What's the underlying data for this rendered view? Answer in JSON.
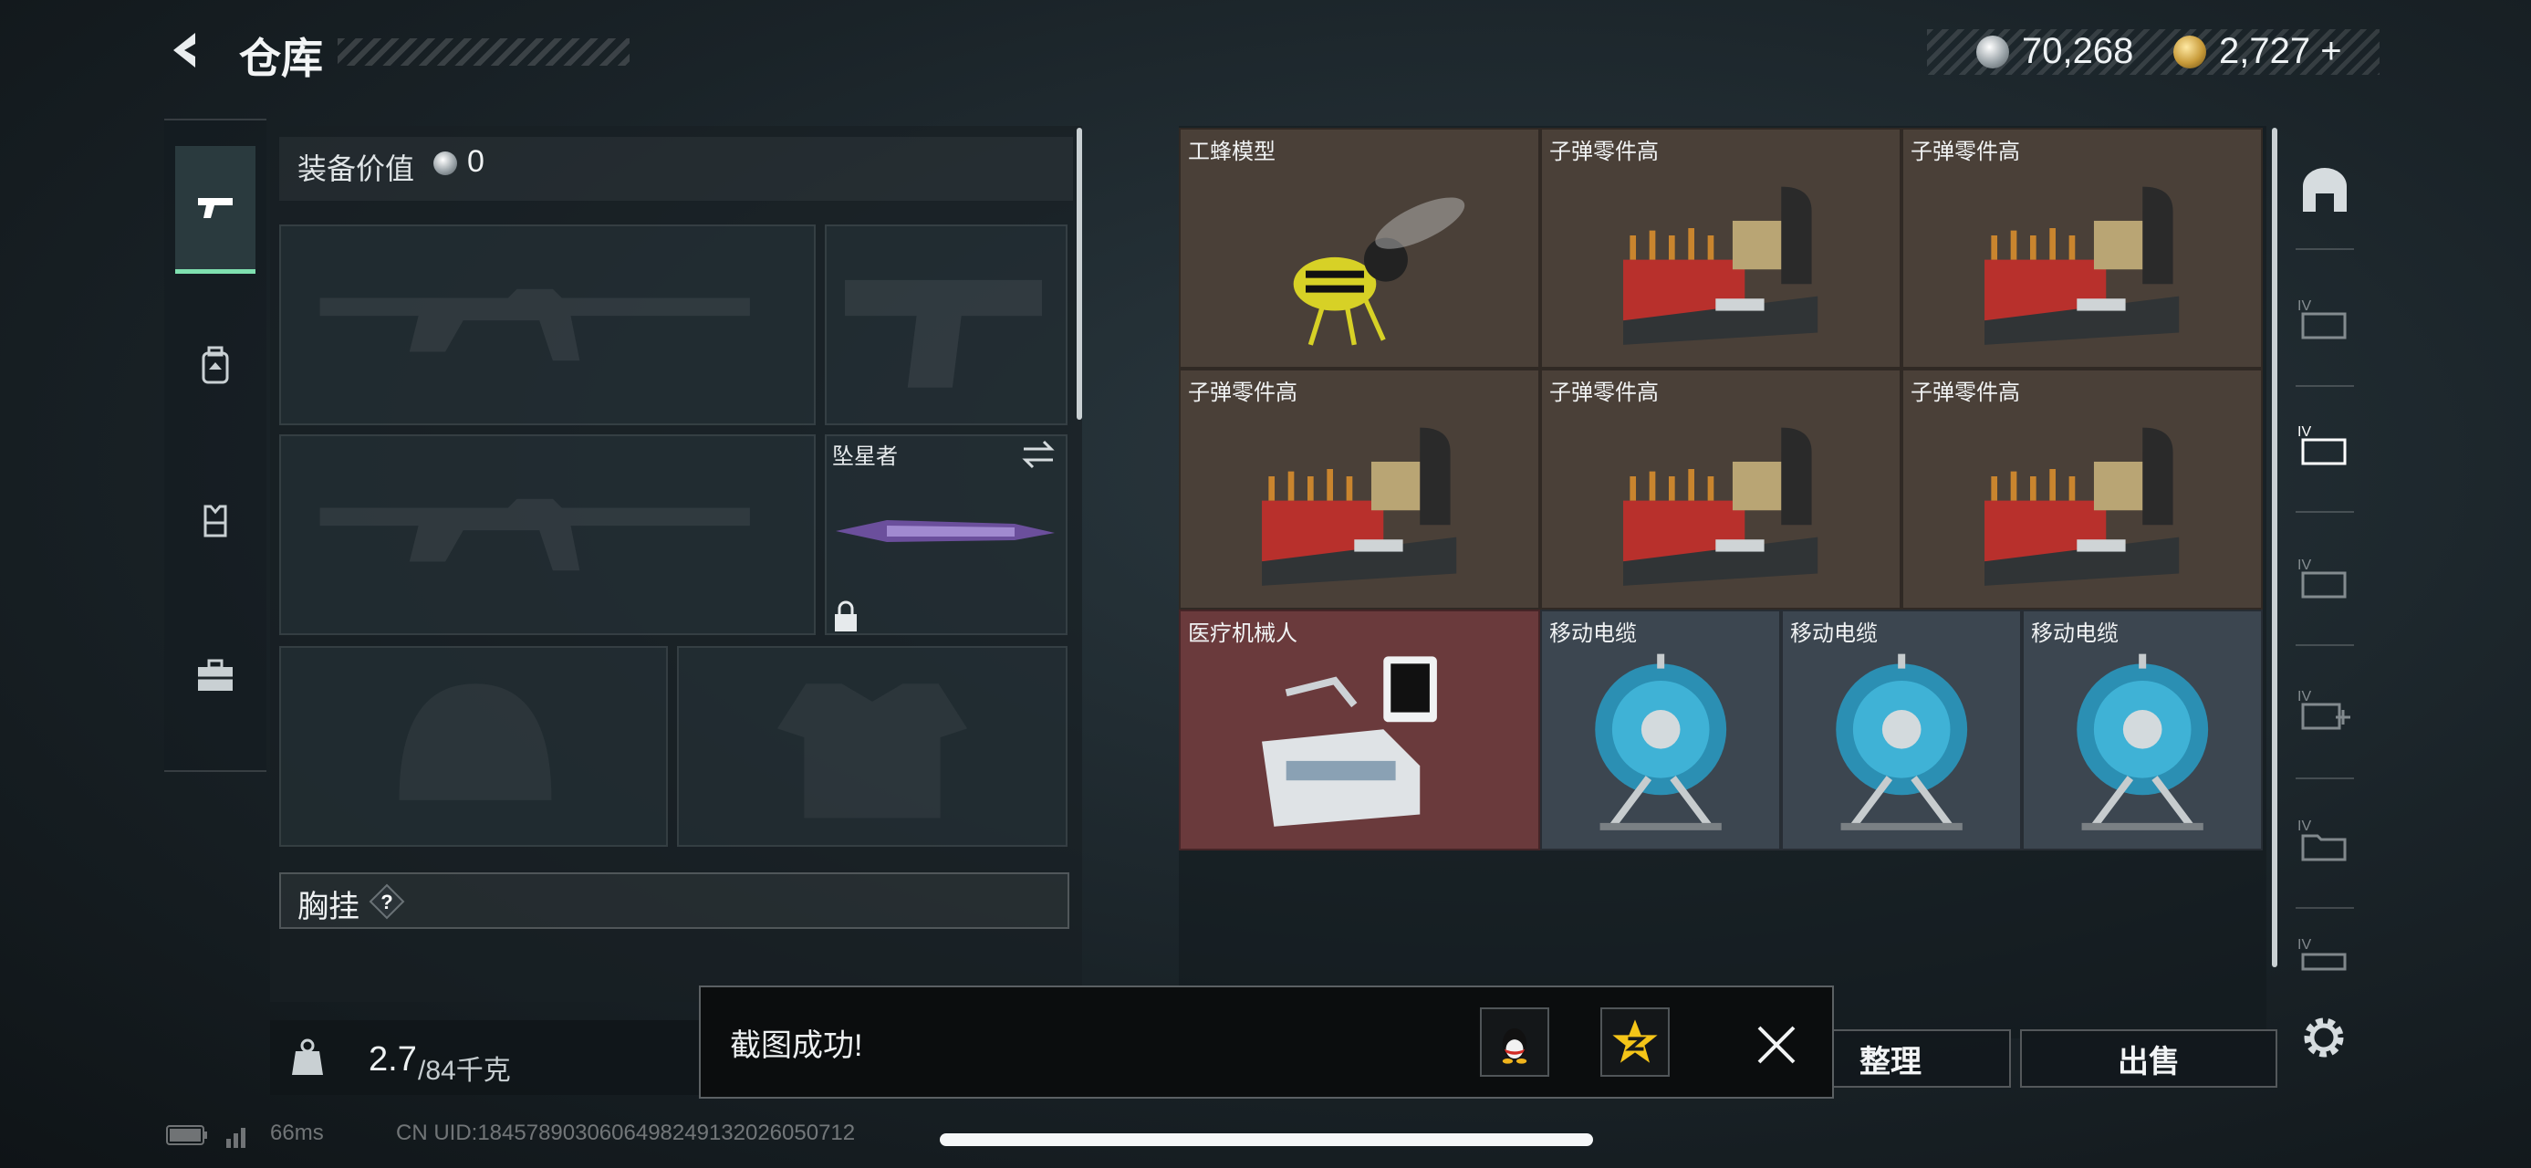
{
  "header": {
    "title": "仓库",
    "silver_amount": "70,268",
    "gold_amount": "2,727",
    "gold_add": "+"
  },
  "left_nav": {
    "items": [
      {
        "icon": "pistol-icon",
        "active": true
      },
      {
        "icon": "backpack-icon",
        "active": false
      },
      {
        "icon": "vest-icon",
        "active": false
      },
      {
        "icon": "case-icon",
        "active": false
      }
    ]
  },
  "equipment": {
    "value_label": "装备价值",
    "value": "0",
    "melee_name": "坠星者",
    "chest_label": "胸挂",
    "chest_help": "?"
  },
  "weight": {
    "current": "2.7",
    "max": "/84千克"
  },
  "storage": {
    "items": [
      {
        "label": "工蜂模型",
        "icon": "bee-model-icon",
        "tint": "brown"
      },
      {
        "label": "子弹零件高",
        "icon": "ammo-parts-icon",
        "tint": "brown"
      },
      {
        "label": "子弹零件高",
        "icon": "ammo-parts-icon",
        "tint": "brown"
      },
      {
        "label": "子弹零件高",
        "icon": "ammo-parts-icon",
        "tint": "brown"
      },
      {
        "label": "子弹零件高",
        "icon": "ammo-parts-icon",
        "tint": "brown"
      },
      {
        "label": "子弹零件高",
        "icon": "ammo-parts-icon",
        "tint": "brown"
      },
      {
        "label": "医疗机械人",
        "icon": "medical-robot-icon",
        "tint": "red"
      },
      {
        "label": "移动电缆",
        "icon": "cable-reel-icon",
        "tint": "blue"
      },
      {
        "label": "移动电缆",
        "icon": "cable-reel-icon",
        "tint": "blue"
      },
      {
        "label": "移动电缆",
        "icon": "cable-reel-icon",
        "tint": "blue"
      }
    ]
  },
  "actions": {
    "sort": "整理",
    "sell": "出售"
  },
  "toast": {
    "message": "截图成功!"
  },
  "status": {
    "ping": "66ms",
    "uid": "CN UID:1845789030606498249132026050712"
  }
}
